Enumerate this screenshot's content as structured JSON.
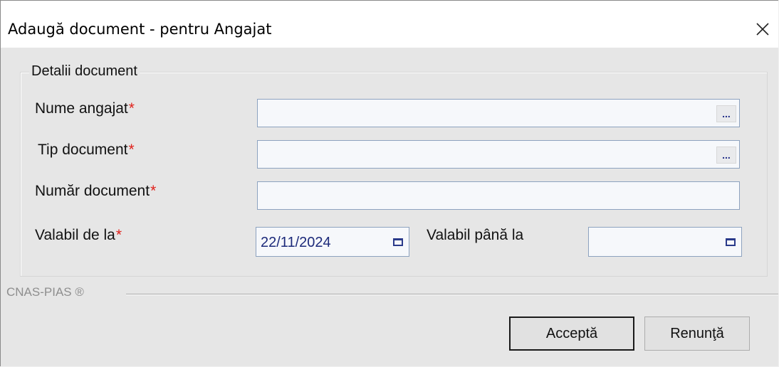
{
  "window": {
    "title": "Adaugă document - pentru Angajat",
    "close_icon": "close-icon"
  },
  "group": {
    "legend": "Detalii document"
  },
  "fields": {
    "employee_name": {
      "label": "Nume angajat",
      "required_mark": "*",
      "value": "",
      "lookup_label": "..."
    },
    "document_type": {
      "label": "Tip document",
      "required_mark": "*",
      "value": "",
      "lookup_label": "..."
    },
    "document_number": {
      "label": "Număr document",
      "required_mark": "*",
      "value": ""
    },
    "valid_from": {
      "label": "Valabil de la",
      "required_mark": "*",
      "value": "22/11/2024",
      "icon": "calendar-icon"
    },
    "valid_until": {
      "label": "Valabil până la",
      "value": "",
      "icon": "calendar-icon"
    }
  },
  "footer": {
    "brand": "CNAS-PIAS ®",
    "accept_label": "Acceptă",
    "cancel_label": "Renunţă"
  },
  "colors": {
    "required": "#e0211b",
    "field_border": "#8da2bf",
    "field_bg": "#f6f8fb",
    "date_text": "#1c2a7a"
  }
}
